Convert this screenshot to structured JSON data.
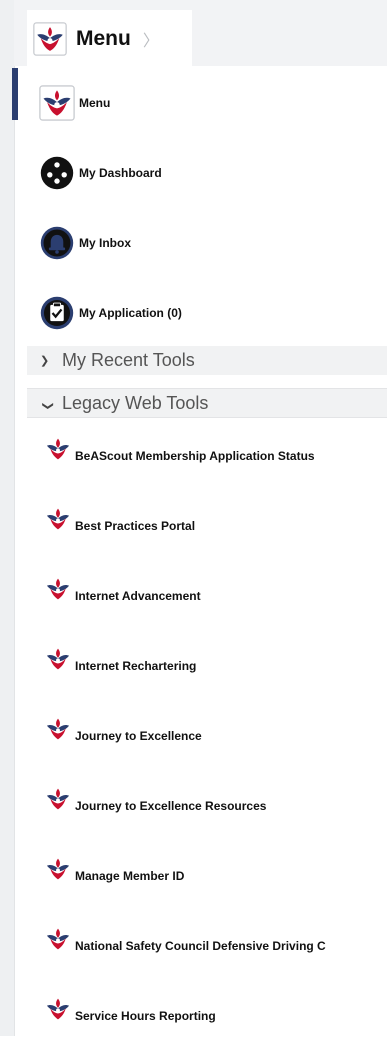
{
  "header": {
    "title": "Menu"
  },
  "nav": {
    "items": [
      {
        "label": "Menu",
        "icon": "bsa-emblem-icon"
      },
      {
        "label": "My Dashboard",
        "icon": "dashboard-icon"
      },
      {
        "label": "My Inbox",
        "icon": "bell-icon"
      },
      {
        "label": "My Application (0)",
        "icon": "application-icon"
      }
    ]
  },
  "sections": {
    "recent": "My Recent Tools",
    "legacy": "Legacy Web Tools"
  },
  "legacy_tools": [
    "BeAScout Membership Application Status",
    "Best Practices Portal",
    "Internet Advancement",
    "Internet Rechartering",
    "Journey to Excellence",
    "Journey to Excellence Resources",
    "Manage Member ID",
    "National Safety Council Defensive Driving C",
    "Service Hours Reporting"
  ],
  "colors": {
    "brand_navy": "#2b3e70",
    "brand_red": "#c8102e",
    "header_bg": "#f2f3f5"
  }
}
